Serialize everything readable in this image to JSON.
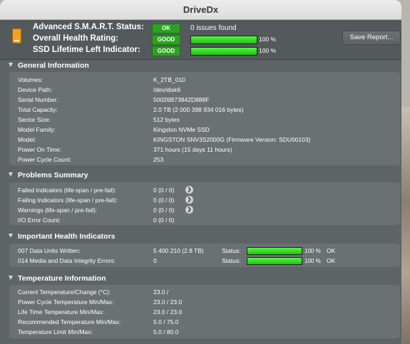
{
  "window": {
    "title": "DriveDx"
  },
  "header": {
    "smart": {
      "label": "Advanced S.M.A.R.T. Status:",
      "badge": "OK",
      "text": "0 issues found"
    },
    "health": {
      "label": "Overall Health Rating:",
      "badge": "GOOD",
      "percent": 100,
      "percent_text": "100 %"
    },
    "ssd": {
      "label": "SSD Lifetime Left Indicator:",
      "badge": "GOOD",
      "percent": 100,
      "percent_text": "100 %"
    },
    "save_report_label": "Save Report..."
  },
  "general": {
    "title": "General Information",
    "rows": [
      {
        "label": "Volumes:",
        "value": "K_2TB_010"
      },
      {
        "label": "Device Path:",
        "value": "/dev/disk6"
      },
      {
        "label": "Serial Number:",
        "value": "50026B73842D888F"
      },
      {
        "label": "Total Capacity:",
        "value": "2.0 TB (2 000 398 934 016 bytes)"
      },
      {
        "label": "Sector Size:",
        "value": "512 bytes"
      },
      {
        "label": "Model Family:",
        "value": "Kingston NVMe SSD"
      },
      {
        "label": "Model:",
        "value": "KINGSTON SNV3S2000G  (Firmware Version: SDU00103)"
      },
      {
        "label": "Power On Time:",
        "value": "371 hours (15 days 11 hours)"
      },
      {
        "label": "Power Cycle Count:",
        "value": "253"
      }
    ]
  },
  "problems": {
    "title": "Problems Summary",
    "rows": [
      {
        "label": "Failed Indicators (life-span / pre-fail):",
        "value": "0 (0 / 0)"
      },
      {
        "label": "Failing Indicators (life-span / pre-fail):",
        "value": "0 (0 / 0)"
      },
      {
        "label": "Warnings (life-span / pre-fail):",
        "value": "0 (0 / 0)"
      },
      {
        "label": "I/O Error Count:",
        "value": "0 (0 / 0)"
      }
    ]
  },
  "health_indicators": {
    "title": "Important Health Indicators",
    "rows": [
      {
        "label": "007  Data Units Written:",
        "value": "5 400 210 (2.8 TB)",
        "status_label": "Status:",
        "percent": 100,
        "percent_text": "100 %",
        "status": "OK"
      },
      {
        "label": "014  Media and Data Integrity Errors:",
        "value": "0",
        "status_label": "Status:",
        "percent": 100,
        "percent_text": "100 %",
        "status": "OK"
      }
    ]
  },
  "temperature": {
    "title": "Temperature Information",
    "rows": [
      {
        "label": "Current Temperature/Change (°C):",
        "value": "23.0 /"
      },
      {
        "label": "Power Cycle Temperature Min/Max:",
        "value": "23.0 / 23.0"
      },
      {
        "label": "Life Time Temperature Min/Max:",
        "value": "23.0 / 23.0"
      },
      {
        "label": "Recommended Temperature Min/Max:",
        "value": "5.0   / 75.0"
      },
      {
        "label": "Temperature Limit Min/Max:",
        "value": "5.0   / 80.0"
      }
    ]
  },
  "colors": {
    "good": "#2ba31f",
    "bar_fill": "#3cdc2c",
    "window_bg": "#5e6366",
    "panel_bg": "#6b7073"
  }
}
